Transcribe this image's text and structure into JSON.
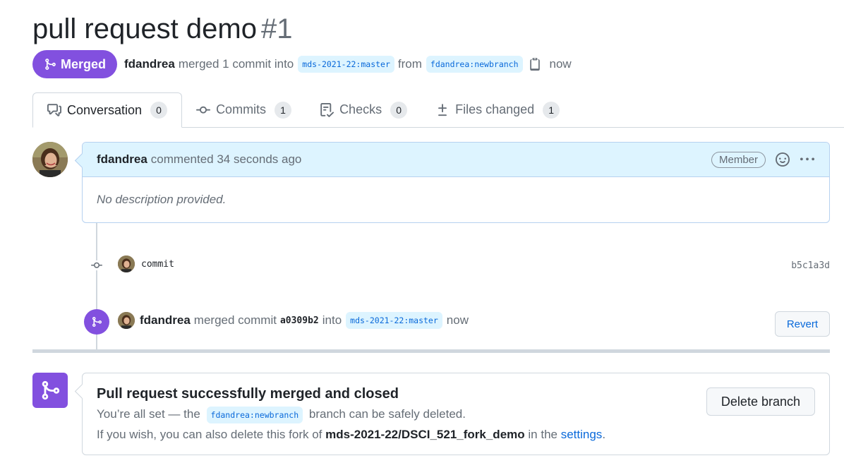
{
  "pr": {
    "title": "pull request demo",
    "number": "#1",
    "state": "Merged",
    "author": "fdandrea",
    "merge_text": "merged 1 commit into",
    "base_branch": "mds-2021-22:master",
    "from_text": "from",
    "head_branch": "fdandrea:newbranch",
    "when": "now"
  },
  "tabs": [
    {
      "label": "Conversation",
      "count": "0",
      "icon": "comment-discussion-icon"
    },
    {
      "label": "Commits",
      "count": "1",
      "icon": "git-commit-icon"
    },
    {
      "label": "Checks",
      "count": "0",
      "icon": "checklist-icon"
    },
    {
      "label": "Files changed",
      "count": "1",
      "icon": "file-diff-icon"
    }
  ],
  "comment": {
    "author": "fdandrea",
    "time": "commented 34 seconds ago",
    "role": "Member",
    "body": "No description provided."
  },
  "commit_event": {
    "message": "commit",
    "sha": "b5c1a3d"
  },
  "merge_event": {
    "author": "fdandrea",
    "text1": "merged commit",
    "sha": "a0309b2",
    "text2": "into",
    "branch": "mds-2021-22:master",
    "when": "now",
    "revert_label": "Revert"
  },
  "merged_box": {
    "title": "Pull request successfully merged and closed",
    "line1_pre": "You’re all set — the",
    "branch": "fdandrea:newbranch",
    "line1_post": "branch can be safely deleted.",
    "line2_pre": "If you wish, you can also delete this fork of",
    "repo": "mds-2021-22/DSCI_521_fork_demo",
    "line2_mid": "in the",
    "settings_link": "settings",
    "line2_post": ".",
    "delete_label": "Delete branch"
  },
  "colors": {
    "merged_purple": "#8250df",
    "link_blue": "#0969da",
    "muted": "#656d76"
  }
}
